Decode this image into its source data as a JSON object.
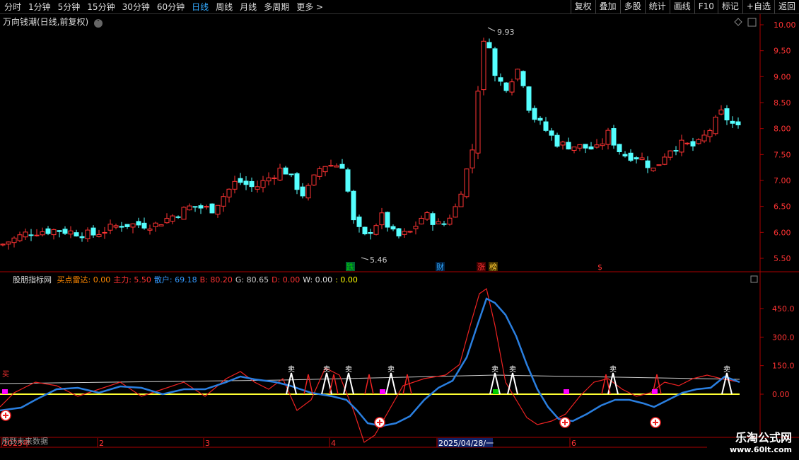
{
  "toolbar": {
    "left": [
      "分时",
      "1分钟",
      "5分钟",
      "15分钟",
      "30分钟",
      "60分钟",
      "日线",
      "周线",
      "月线",
      "多周期",
      "更多 >"
    ],
    "active_index": 6,
    "right": [
      "复权",
      "叠加",
      "多股",
      "统计",
      "画线",
      "F10",
      "标记",
      "+自选",
      "返回"
    ]
  },
  "main_title": "万向钱潮(日线,前复权)",
  "price_axis": [
    "10.00",
    "9.50",
    "9.00",
    "8.50",
    "8.00",
    "7.50",
    "7.00",
    "6.50",
    "6.00",
    "5.50"
  ],
  "high_label": "9.93",
  "low_label": "5.46",
  "markers": [
    {
      "text": "跌",
      "color": "#0c0",
      "bg": "#063"
    },
    {
      "text": "财",
      "color": "#3af",
      "bg": "#024"
    },
    {
      "text": "涨",
      "color": "#f33",
      "bg": "#400"
    },
    {
      "text": "榜",
      "color": "#fc3",
      "bg": "#430"
    },
    {
      "text": "$",
      "color": "#f33",
      "bg": "none"
    }
  ],
  "indicator": {
    "name": "股朋指标网",
    "items": [
      {
        "label": "买点雷达: 0.00",
        "color": "#f80"
      },
      {
        "label": "主力: 5.50",
        "color": "#f33"
      },
      {
        "label": "散户: 69.18",
        "color": "#39f"
      },
      {
        "label": "B: 80.20",
        "color": "#f33"
      },
      {
        "label": "G: 80.65",
        "color": "#ccc"
      },
      {
        "label": "D: 0.00",
        "color": "#f33"
      },
      {
        "label": "W: 0.00",
        "color": "#ddd"
      },
      {
        "label": ": 0.00",
        "color": "#ff0"
      }
    ],
    "axis": [
      "450.0",
      "300.0",
      "150.0",
      "0.00"
    ],
    "sell_label": "卖",
    "buy_label": "买"
  },
  "future_note": "用到未来数据",
  "date_axis": [
    "2025年",
    "2",
    "3",
    "4",
    "2025/04/28/一",
    "6"
  ],
  "brand": {
    "name": "乐淘公式网",
    "url": "www.60lt.com"
  }
}
